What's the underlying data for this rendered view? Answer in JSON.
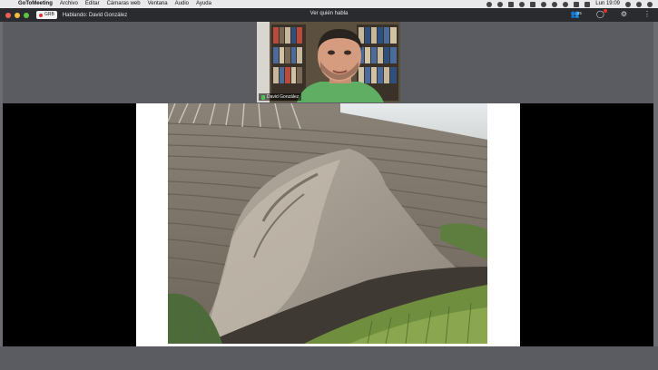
{
  "menubar": {
    "app_name": "GoToMeeting",
    "items": [
      "Archivo",
      "Editar",
      "Cámaras web",
      "Ventana",
      "Audio",
      "Ayuda"
    ],
    "clock": "Lun 19:09"
  },
  "titlebar": {
    "recording_label": "GRB",
    "speaking_label": "Hablando: David González",
    "view_toggle": "Ver quién habla",
    "attendee_count": "35"
  },
  "camera": {
    "participant_name": "David González"
  }
}
